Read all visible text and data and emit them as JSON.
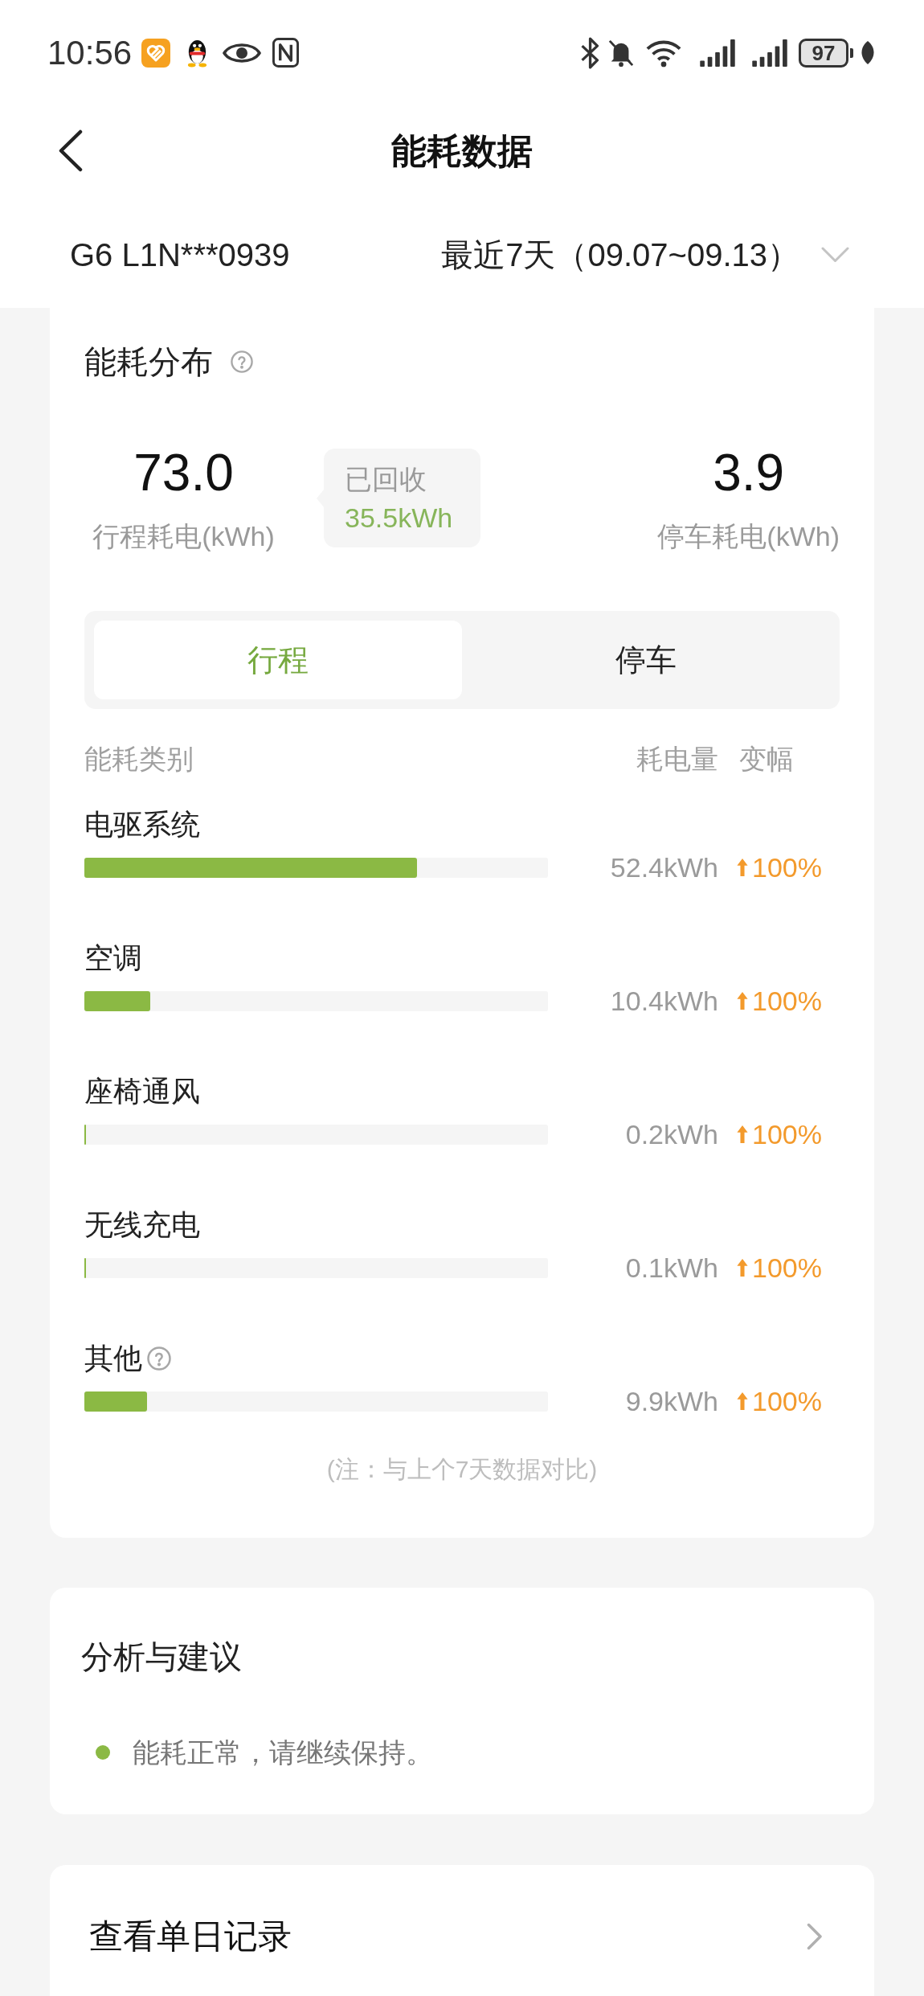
{
  "status_bar": {
    "time": "10:56",
    "battery": "97"
  },
  "header": {
    "title": "能耗数据"
  },
  "vehicle_bar": {
    "vehicle": "G6 L1N***0939",
    "period": "最近7天（09.07~09.13）"
  },
  "distribution": {
    "title": "能耗分布",
    "driving": {
      "value": "73.0",
      "label": "行程耗电(kWh)"
    },
    "recovered": {
      "label": "已回收",
      "value": "35.5kWh"
    },
    "parking": {
      "value": "3.9",
      "label": "停车耗电(kWh)"
    },
    "tabs": [
      {
        "label": "行程",
        "selected": true
      },
      {
        "label": "停车",
        "selected": false
      }
    ],
    "columns": [
      "能耗类别",
      "耗电量",
      "变幅"
    ],
    "rows": [
      {
        "name": "电驱系统",
        "info": false,
        "level": 0.718,
        "amount": "52.4kWh",
        "rising": true,
        "change": "100%"
      },
      {
        "name": "空调",
        "info": false,
        "level": 0.142,
        "amount": "10.4kWh",
        "rising": true,
        "change": "100%"
      },
      {
        "name": "座椅通风",
        "info": false,
        "level": 0.004,
        "amount": "0.2kWh",
        "rising": true,
        "change": "100%"
      },
      {
        "name": "无线充电",
        "info": false,
        "level": 0.003,
        "amount": "0.1kWh",
        "rising": true,
        "change": "100%"
      },
      {
        "name": "其他",
        "info": true,
        "level": 0.136,
        "amount": "9.9kWh",
        "rising": true,
        "change": "100%"
      }
    ],
    "note": "(注：与上个7天数据对比)"
  },
  "analysis": {
    "title": "分析与建议",
    "items": [
      {
        "text": "能耗正常，请继续保持。",
        "color": "#8bb944"
      }
    ]
  },
  "daily_records": {
    "label": "查看单日记录"
  }
}
